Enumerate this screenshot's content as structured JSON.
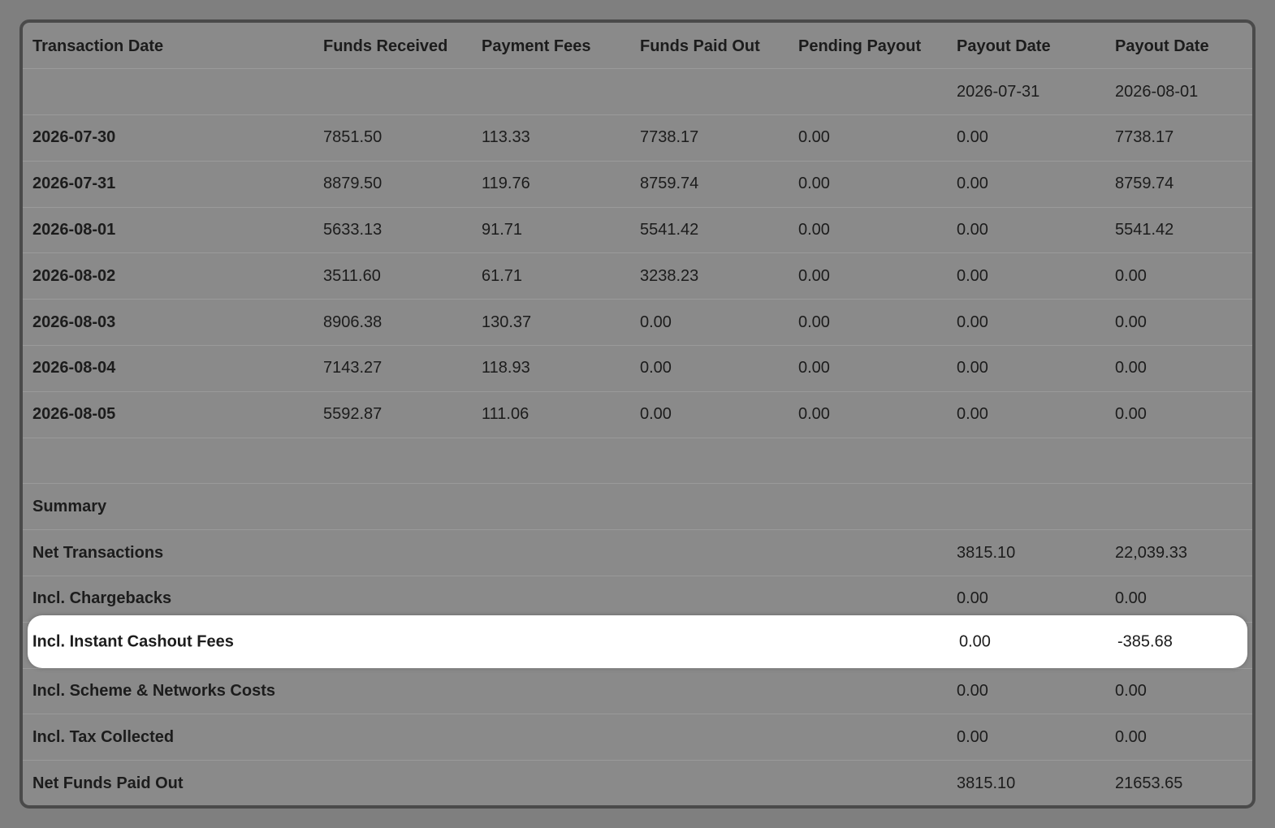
{
  "table": {
    "headers": [
      "Transaction Date",
      "Funds Received",
      "Payment Fees",
      "Funds Paid Out",
      "Pending Payout",
      "Payout Date",
      "Payout Date"
    ],
    "payout_dates": [
      "2026-07-31",
      "2026-08-01"
    ],
    "rows": [
      {
        "date": "2026-07-30",
        "received": "7851.50",
        "fees": "113.33",
        "paid_out": "7738.17",
        "pending": "0.00",
        "payout1": "0.00",
        "payout2": "7738.17"
      },
      {
        "date": "2026-07-31",
        "received": "8879.50",
        "fees": "119.76",
        "paid_out": "8759.74",
        "pending": "0.00",
        "payout1": "0.00",
        "payout2": "8759.74"
      },
      {
        "date": "2026-08-01",
        "received": "5633.13",
        "fees": "91.71",
        "paid_out": "5541.42",
        "pending": "0.00",
        "payout1": "0.00",
        "payout2": "5541.42"
      },
      {
        "date": "2026-08-02",
        "received": "3511.60",
        "fees": "61.71",
        "paid_out": "3238.23",
        "pending": "0.00",
        "payout1": "0.00",
        "payout2": "0.00"
      },
      {
        "date": "2026-08-03",
        "received": "8906.38",
        "fees": "130.37",
        "paid_out": "0.00",
        "pending": "0.00",
        "payout1": "0.00",
        "payout2": "0.00"
      },
      {
        "date": "2026-08-04",
        "received": "7143.27",
        "fees": "118.93",
        "paid_out": "0.00",
        "pending": "0.00",
        "payout1": "0.00",
        "payout2": "0.00"
      },
      {
        "date": "2026-08-05",
        "received": "5592.87",
        "fees": "111.06",
        "paid_out": "0.00",
        "pending": "0.00",
        "payout1": "0.00",
        "payout2": "0.00"
      }
    ]
  },
  "summary": {
    "title": "Summary",
    "rows": [
      {
        "label": "Net Transactions",
        "v1": "3815.10",
        "v2": "22,039.33"
      },
      {
        "label": "Incl. Chargebacks",
        "v1": "0.00",
        "v2": "0.00"
      },
      {
        "label": "Incl. Instant Cashout Fees",
        "v1": "0.00",
        "v2": "-385.68"
      },
      {
        "label": "Incl. Scheme & Networks Costs",
        "v1": "0.00",
        "v2": "0.00"
      },
      {
        "label": "Incl. Tax Collected",
        "v1": "0.00",
        "v2": "0.00"
      },
      {
        "label": "Net Funds Paid Out",
        "v1": "3815.10",
        "v2": "21653.65"
      }
    ]
  },
  "colors": {
    "backdrop": "#7f7f7f",
    "panel": "#8a8a8a",
    "highlight": "#ffffff"
  }
}
